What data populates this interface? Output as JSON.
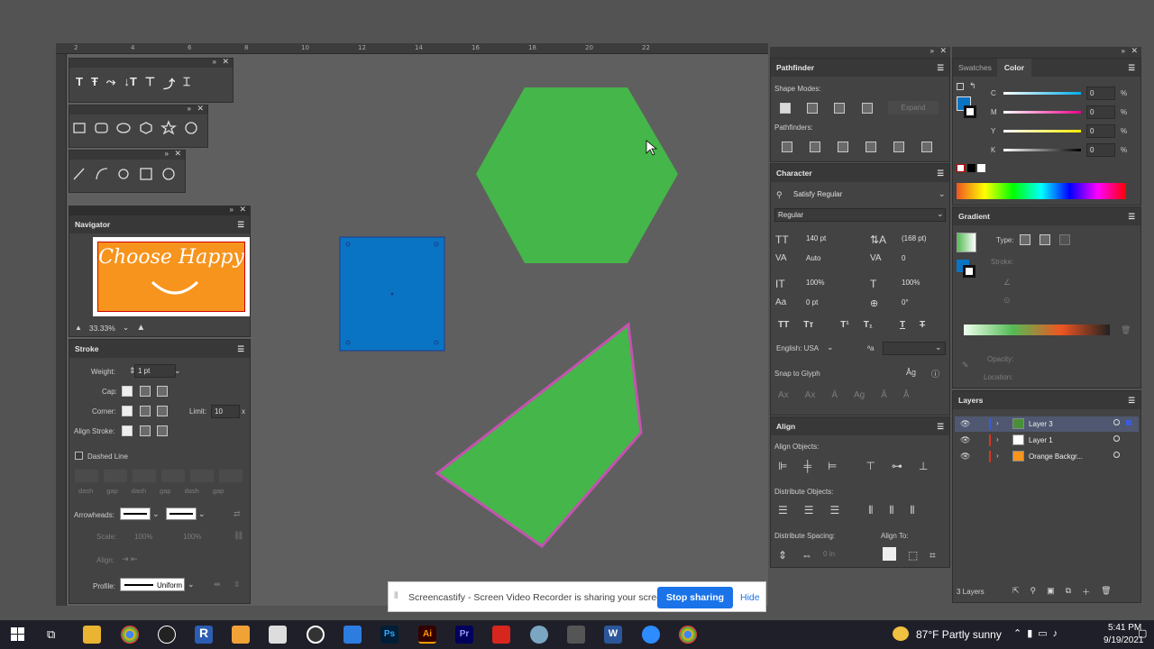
{
  "ruler_ticks": [
    "2",
    "4",
    "6",
    "8",
    "10",
    "12",
    "14",
    "16",
    "18",
    "20",
    "22"
  ],
  "navigator": {
    "title": "Navigator",
    "thumb_text": "Choose Happy",
    "zoom": "33.33%"
  },
  "stroke": {
    "title": "Stroke",
    "weight_label": "Weight:",
    "weight_value": "1 pt",
    "cap_label": "Cap:",
    "corner_label": "Corner:",
    "limit_label": "Limit:",
    "limit_value": "10",
    "limit_x": "x",
    "align_label": "Align Stroke:",
    "dashed_label": "Dashed Line",
    "dash_labels": [
      "dash",
      "gap",
      "dash",
      "gap",
      "dash",
      "gap"
    ],
    "arrowheads_label": "Arrowheads:",
    "scale_label": "Scale:",
    "scale_values": [
      "100%",
      "100%"
    ],
    "align2_label": "Align:",
    "profile_label": "Profile:",
    "profile_value": "Uniform"
  },
  "pathfinder": {
    "title": "Pathfinder",
    "shape_modes": "Shape Modes:",
    "expand": "Expand",
    "pathfinders": "Pathfinders:"
  },
  "character": {
    "title": "Character",
    "font": "Satisfy Regular",
    "style": "Regular",
    "size": "140 pt",
    "leading": "(168 pt)",
    "kerning": "Auto",
    "tracking": "0",
    "vscale": "100%",
    "hscale": "100%",
    "baseline": "0 pt",
    "rotation": "0°",
    "language": "English: USA",
    "aa_label": "ªa",
    "snap": "Snap to Glyph"
  },
  "align": {
    "title": "Align",
    "align_objects": "Align Objects:",
    "distribute_objects": "Distribute Objects:",
    "distribute_spacing": "Distribute Spacing:",
    "align_to": "Align To:",
    "spacing_value": "0 in"
  },
  "color": {
    "tab_swatches": "Swatches",
    "tab_color": "Color",
    "channels": [
      {
        "label": "C",
        "value": "0",
        "pct": "%"
      },
      {
        "label": "M",
        "value": "0",
        "pct": "%"
      },
      {
        "label": "Y",
        "value": "0",
        "pct": "%"
      },
      {
        "label": "K",
        "value": "0",
        "pct": "%"
      }
    ]
  },
  "gradient": {
    "title": "Gradient",
    "type_label": "Type:",
    "stroke_label": "Stroke:",
    "opacity_label": "Opacity:",
    "location_label": "Location:"
  },
  "layers": {
    "title": "Layers",
    "items": [
      {
        "name": "Layer 3",
        "color": "#3b5bdb"
      },
      {
        "name": "Layer 1",
        "color": "#d9361c"
      },
      {
        "name": "Orange Backgr...",
        "color": "#d9361c"
      }
    ],
    "count": "3 Layers"
  },
  "share": {
    "message": "Screencastify - Screen Video Recorder is sharing your screen.",
    "stop": "Stop sharing",
    "hide": "Hide"
  },
  "taskbar": {
    "weather": "87°F  Partly sunny",
    "time": "5:41 PM",
    "date": "9/19/2021"
  },
  "colors": {
    "accent_blue": "#0a74c4",
    "shape_green": "#45b649",
    "stroke_pink": "#c452b0",
    "orange": "#f7941d"
  }
}
